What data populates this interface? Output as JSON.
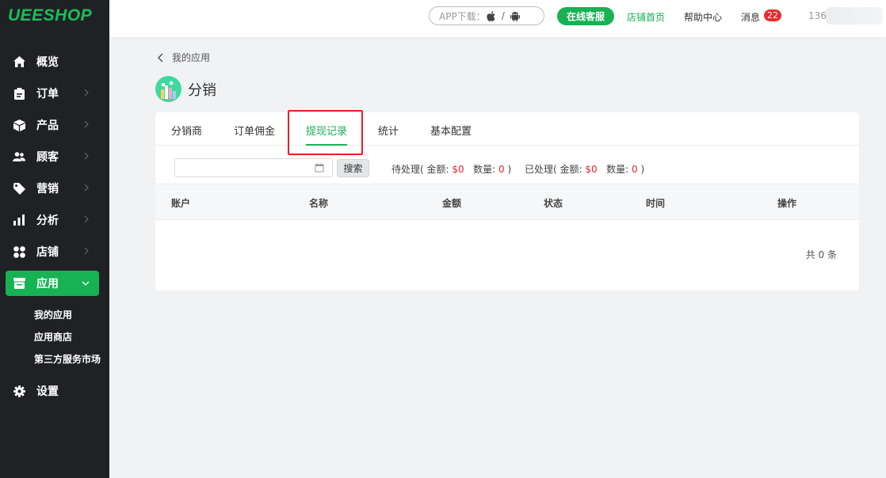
{
  "logo": "UEESHOP",
  "header": {
    "app_download": "APP下载：",
    "separator": "/",
    "service_button": "在线客服",
    "store_home": "店铺首页",
    "help_center": "帮助中心",
    "messages": "消息",
    "message_count": "22",
    "user_partial": "136",
    "accent_color": "#16b254"
  },
  "sidebar": {
    "items": [
      {
        "label": "概览",
        "icon": "home-icon"
      },
      {
        "label": "订单",
        "icon": "clipboard-icon"
      },
      {
        "label": "产品",
        "icon": "box-icon"
      },
      {
        "label": "顾客",
        "icon": "users-icon"
      },
      {
        "label": "营销",
        "icon": "tag-icon"
      },
      {
        "label": "分析",
        "icon": "bar-chart-icon"
      },
      {
        "label": "店铺",
        "icon": "grid-icon"
      },
      {
        "label": "应用",
        "icon": "store-icon"
      },
      {
        "label": "设置",
        "icon": "gear-icon"
      }
    ],
    "sub_items": [
      "我的应用",
      "应用商店",
      "第三方服务市场"
    ]
  },
  "page": {
    "back_label": "我的应用",
    "title": "分销"
  },
  "tabs": [
    "分销商",
    "订单佣金",
    "提现记录",
    "统计",
    "基本配置"
  ],
  "active_tab": "提现记录",
  "filters": {
    "date_value": "",
    "search_button": "搜索",
    "pending": {
      "label": "待处理( 金额:",
      "amount": "$0",
      "count_label": "数量:",
      "count": "0",
      "close": ")"
    },
    "processed": {
      "label": "已处理( 金额:",
      "amount": "$0",
      "count_label": "数量:",
      "count": "0",
      "close": ")"
    }
  },
  "table": {
    "columns": [
      "账户",
      "名称",
      "金额",
      "状态",
      "时间",
      "操作"
    ],
    "rows": [],
    "total": "共 0 条"
  }
}
